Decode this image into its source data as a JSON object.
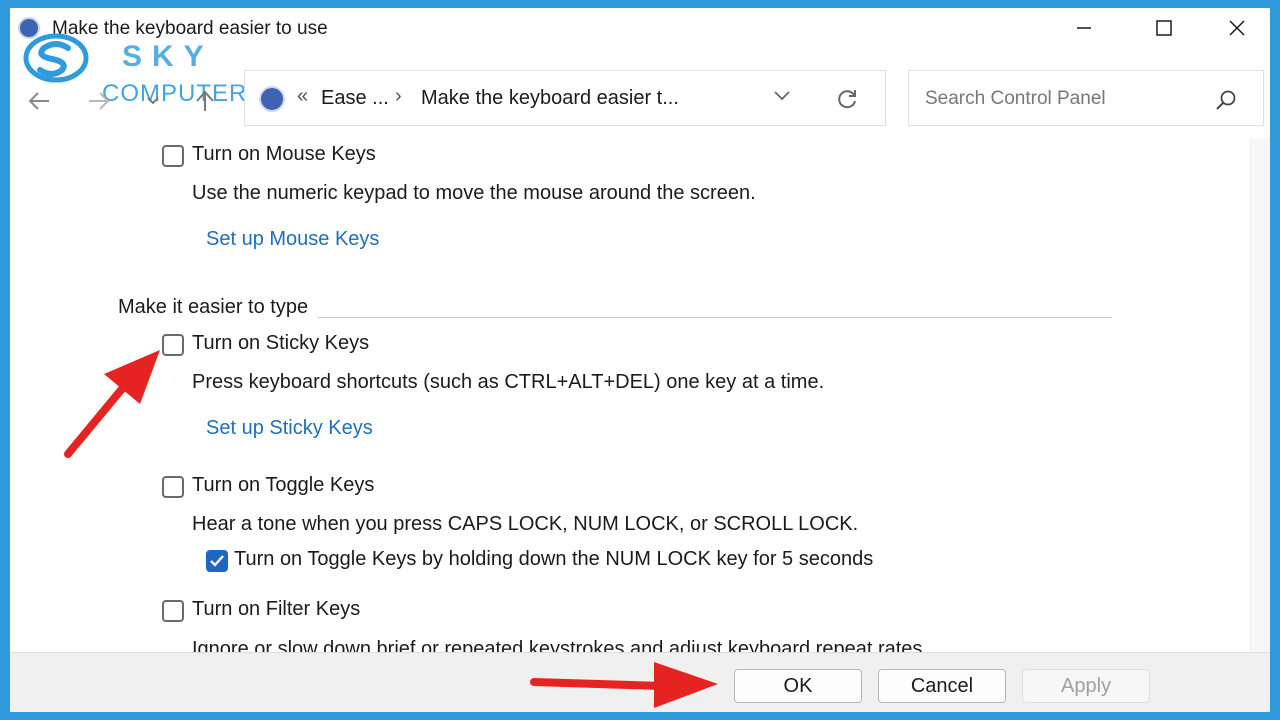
{
  "window": {
    "title": "Make the keyboard easier to use"
  },
  "watermark": {
    "brand_top": "SKY",
    "brand_bottom": "COMPUTER"
  },
  "address": {
    "crumb_parent": "Ease ...",
    "separator": "›",
    "crumb_current": "Make the keyboard easier t...",
    "back_chevrons": "«"
  },
  "search": {
    "placeholder": "Search Control Panel"
  },
  "content": {
    "mouse_keys": {
      "checkbox_label": "Turn on Mouse Keys",
      "checked": false,
      "description": "Use the numeric keypad to move the mouse around the screen.",
      "link": "Set up Mouse Keys"
    },
    "section_heading": "Make it easier to type",
    "sticky_keys": {
      "checkbox_label": "Turn on Sticky Keys",
      "checked": false,
      "description": "Press keyboard shortcuts (such as CTRL+ALT+DEL) one key at a time.",
      "link": "Set up Sticky Keys"
    },
    "toggle_keys": {
      "checkbox_label": "Turn on Toggle Keys",
      "checked": false,
      "description": "Hear a tone when you press CAPS LOCK, NUM LOCK, or SCROLL LOCK.",
      "sub_checkbox_label": "Turn on Toggle Keys by holding down the NUM LOCK key for 5 seconds",
      "sub_checked": true
    },
    "filter_keys": {
      "checkbox_label": "Turn on Filter Keys",
      "checked": false,
      "description": "Ignore or slow down brief or repeated keystrokes and adjust keyboard repeat rates."
    }
  },
  "footer": {
    "ok_label": "OK",
    "cancel_label": "Cancel",
    "apply_label": "Apply"
  },
  "colors": {
    "accent_link": "#1f6fb8",
    "checkbox_checked": "#1f66c2",
    "arrow": "#e52421",
    "frame": "#2f9bdc"
  }
}
